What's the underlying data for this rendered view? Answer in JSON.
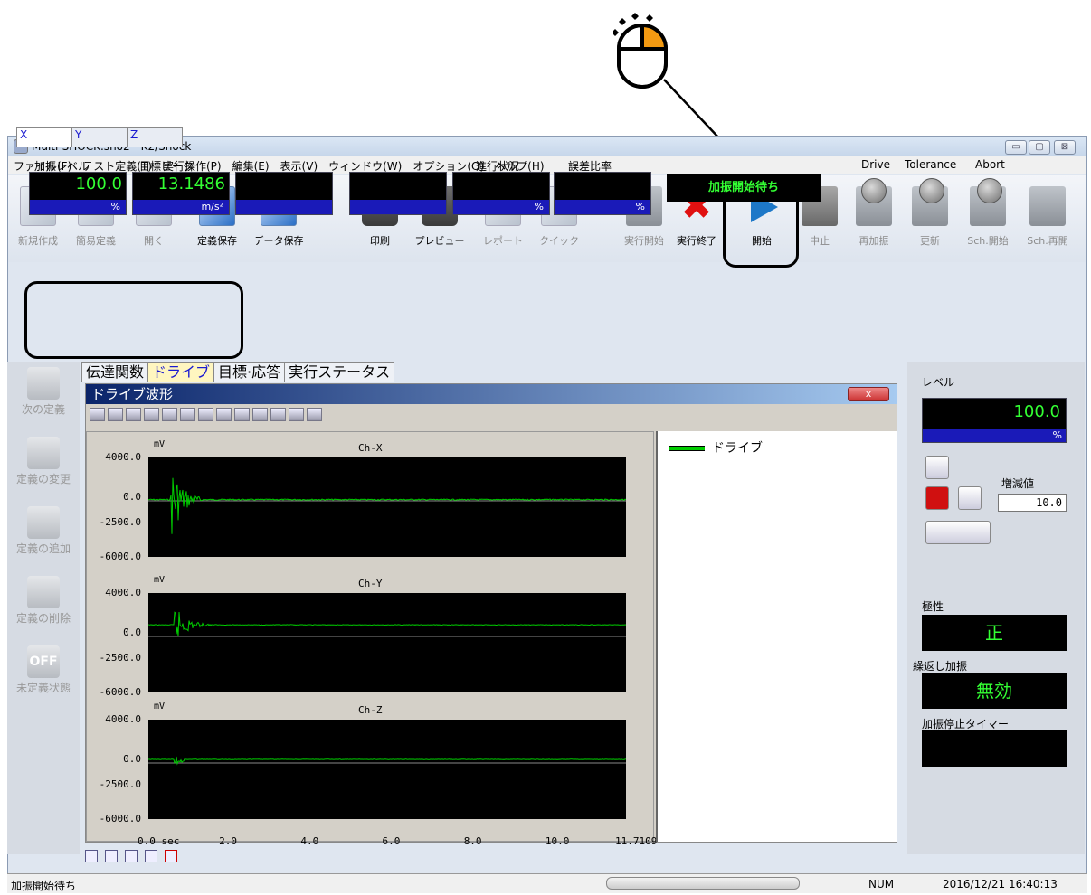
{
  "window": {
    "title": "Multi-SHOCK.sho2 - K2/Shock",
    "controls": [
      "▭",
      "▢",
      "⊠"
    ]
  },
  "menu": [
    "ファイル(F)",
    "テスト定義(T)",
    "実行操作(P)",
    "編集(E)",
    "表示(V)",
    "ウィンドウ(W)",
    "オプション(O)",
    "ヘルプ(H)"
  ],
  "toolbar": {
    "new": "新規作成",
    "simple": "簡易定義",
    "open": "開く",
    "def_save": "定義保存",
    "data_save": "データ保存",
    "print": "印刷",
    "preview": "プレビュー",
    "report": "レポート",
    "quick": "クイック",
    "exec_start": "実行開始",
    "exec_end": "実行終了",
    "start": "開始",
    "stop": "中止",
    "reshake": "再加振",
    "update": "更新",
    "sch_start": "Sch.開始",
    "sch_resume": "Sch.再開"
  },
  "axis_tabs": [
    "X",
    "Y",
    "Z"
  ],
  "meters": {
    "level_label": "加振レベル",
    "level_value": "100.0",
    "level_unit": "%",
    "peak_label": "目標ピーク",
    "peak_value": "13.1486",
    "peak_unit": "m/s²",
    "progress_label": "進行状況",
    "progress_unit": "%",
    "error_label": "誤差比率",
    "error_unit": "%"
  },
  "status_display": "加振開始待ち",
  "leds": {
    "drive": "Drive",
    "tolerance": "Tolerance",
    "abort": "Abort"
  },
  "left_panel": {
    "next": "次の定義",
    "change": "定義の変更",
    "add": "定義の追加",
    "delete": "定義の削除",
    "undefined": "未定義状態",
    "off": "OFF"
  },
  "sub_tabs": [
    "伝達関数",
    "ドライブ",
    "目標·応答",
    "実行ステータス"
  ],
  "inner_window": {
    "title": "ドライブ波形",
    "close": "x"
  },
  "legend": {
    "drive": "ドライブ"
  },
  "chart_data": {
    "type": "line",
    "x_unit": "sec",
    "x_ticks": [
      "0.0",
      "2.0",
      "4.0",
      "6.0",
      "8.0",
      "10.0",
      "11.7109"
    ],
    "xlim": [
      0,
      11.7109
    ],
    "channels": [
      {
        "name": "Ch-X",
        "unit": "mV",
        "y_ticks": [
          "4000.0",
          "0.0",
          "-2500.0",
          "-6000.0"
        ],
        "ylim": [
          -6000,
          4000
        ]
      },
      {
        "name": "Ch-Y",
        "unit": "mV",
        "y_ticks": [
          "4000.0",
          "0.0",
          "-2500.0",
          "-6000.0"
        ],
        "ylim": [
          -6000,
          4000
        ]
      },
      {
        "name": "Ch-Z",
        "unit": "mV",
        "y_ticks": [
          "4000.0",
          "0.0",
          "-2500.0",
          "-6000.0"
        ],
        "ylim": [
          -6000,
          4000
        ]
      }
    ],
    "x0_label": "0.0 sec",
    "line_color": "#00cc00"
  },
  "right_panel": {
    "level_label": "レベル",
    "level_value": "100.0",
    "level_unit": "%",
    "step_label": "増減値",
    "step_value": "10.0",
    "polarity_label": "極性",
    "polarity_value": "正",
    "repeat_label": "繰返し加振",
    "repeat_value": "無効",
    "timer_label": "加振停止タイマー",
    "timer_value": ""
  },
  "statusbar": {
    "message": "加振開始待ち",
    "num": "NUM",
    "datetime": "2016/12/21  16:40:13"
  }
}
